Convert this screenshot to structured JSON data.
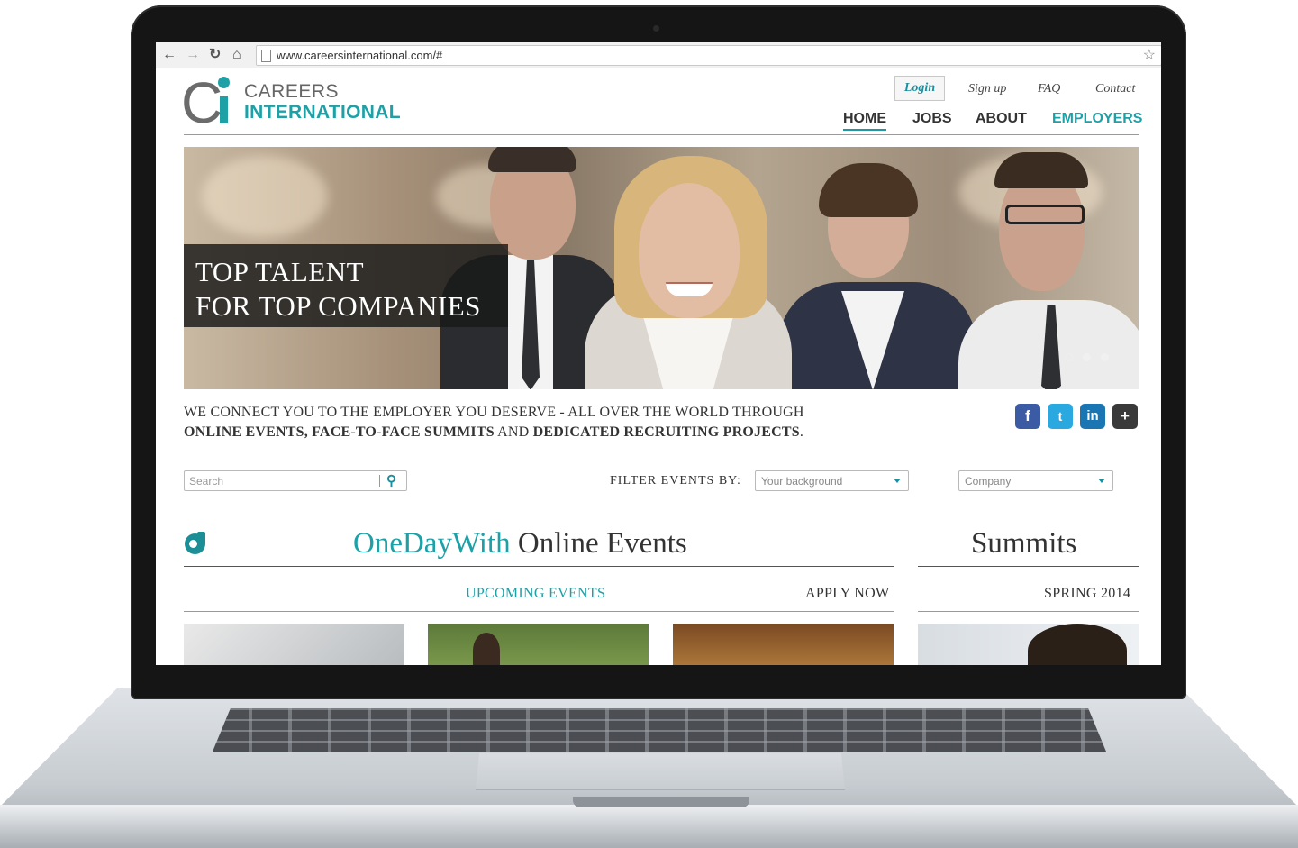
{
  "browser": {
    "url": "www.careersinternational.com/#"
  },
  "logo": {
    "mark": "Ci",
    "line1": "CAREERS",
    "line2": "INTERNATIONAL"
  },
  "top_links": {
    "login": "Login",
    "signup": "Sign up",
    "faq": "FAQ",
    "contact": "Contact"
  },
  "nav": {
    "home": "HOME",
    "jobs": "JOBS",
    "about": "ABOUT",
    "employers": "EMPLOYERS"
  },
  "hero": {
    "line1": "TOP TALENT",
    "line2": "FOR TOP COMPANIES",
    "slides": 3,
    "active_slide": 1
  },
  "tagline": {
    "line1": "WE CONNECT YOU TO THE EMPLOYER YOU DESERVE - ALL OVER THE WORLD THROUGH",
    "bold1": "ONLINE EVENTS, FACE-TO-FACE SUMMITS",
    "mid": " AND ",
    "bold2": "DEDICATED RECRUITING PROJECTS",
    "end": "."
  },
  "social": {
    "facebook": "f",
    "twitter": "t",
    "linkedin": "in",
    "googleplus": "+"
  },
  "filters": {
    "search_placeholder": "Search",
    "label": "FILTER EVENTS BY:",
    "background": "Your background",
    "company": "Company"
  },
  "events": {
    "title_teal": "OneDayWith",
    "title_rest": " Online Events",
    "upcoming": "UPCOMING EVENTS",
    "apply": "APPLY NOW"
  },
  "summits": {
    "title": "Summits",
    "season": "SPRING 2014"
  },
  "colors": {
    "brand_teal": "#1da1a7",
    "text_dark": "#333333"
  }
}
